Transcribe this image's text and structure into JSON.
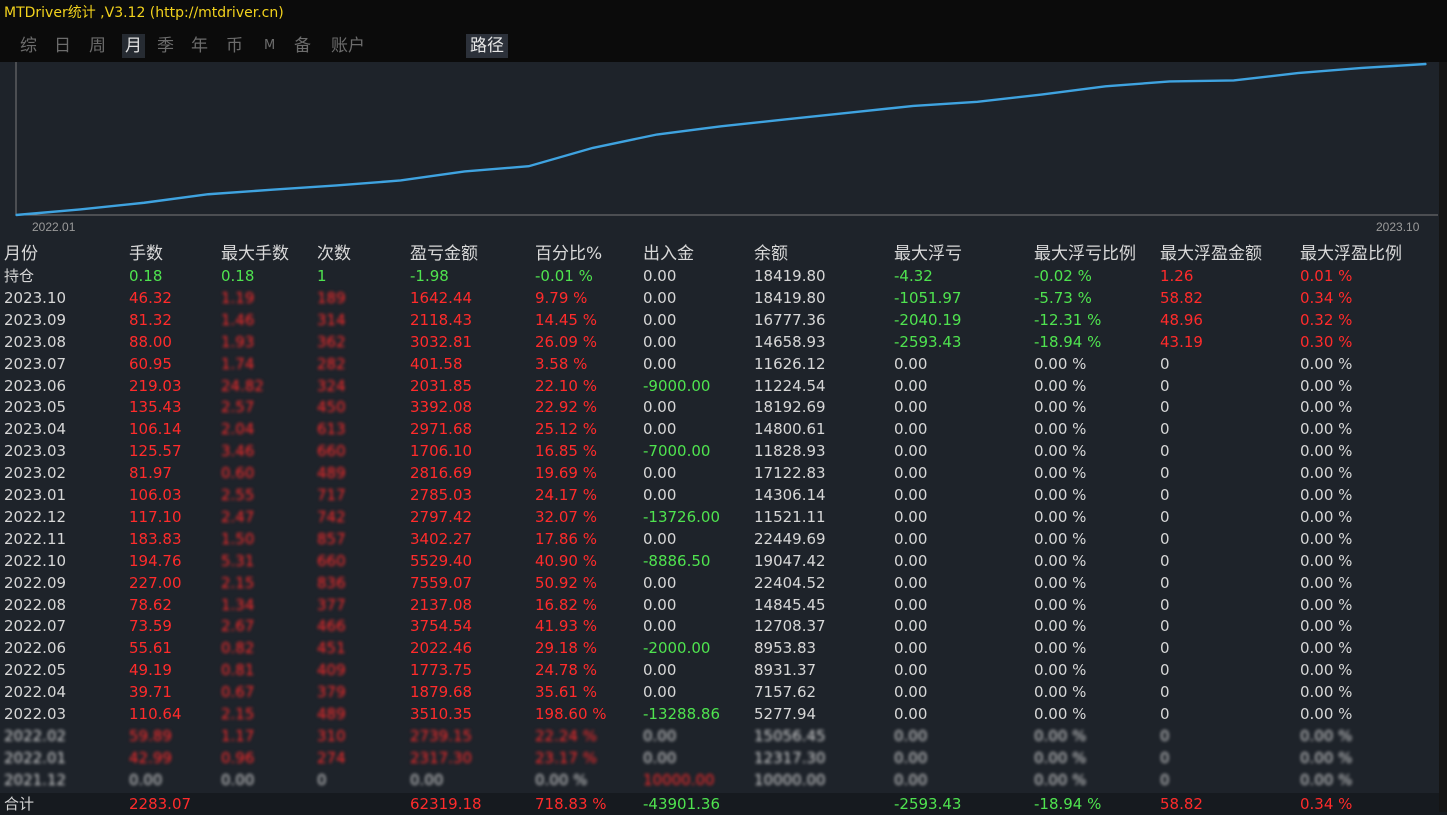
{
  "window": {
    "title": "MTDriver统计 ,V3.12 (http://mtdriver.cn)"
  },
  "tabs": [
    {
      "label": "综",
      "active": false
    },
    {
      "label": "日",
      "active": false
    },
    {
      "label": "周",
      "active": false
    },
    {
      "label": "月",
      "active": true
    },
    {
      "label": "季",
      "active": false
    },
    {
      "label": "年",
      "active": false
    },
    {
      "label": "币",
      "active": false
    },
    {
      "label": "M",
      "active": false
    },
    {
      "label": "备",
      "active": false
    },
    {
      "label": "账户",
      "active": false
    }
  ],
  "path_button": "路径",
  "chart_data": {
    "type": "line",
    "x_start_label": "2022.01",
    "x_end_label": "2023.10",
    "line_color": "#3fa3e0",
    "x": [
      "2021.12",
      "2022.01",
      "2022.02",
      "2022.03",
      "2022.04",
      "2022.05",
      "2022.06",
      "2022.07",
      "2022.08",
      "2022.09",
      "2022.10",
      "2022.11",
      "2022.12",
      "2023.01",
      "2023.02",
      "2023.03",
      "2023.04",
      "2023.05",
      "2023.06",
      "2023.07",
      "2023.08",
      "2023.09",
      "2023.10"
    ],
    "values": [
      0,
      2317,
      5056,
      8566,
      10446,
      12219,
      14241,
      17996,
      20133,
      27692,
      33221,
      36624,
      39421,
      42206,
      45023,
      46729,
      49700,
      53093,
      55124,
      55526,
      58559,
      60677,
      62319
    ]
  },
  "colors": {
    "red": "#ff2b2b",
    "green": "#4fe34f",
    "white": "#d7d7d7"
  },
  "table": {
    "headers": [
      "月份",
      "手数",
      "最大手数",
      "次数",
      "盈亏金额",
      "百分比%",
      "出入金",
      "余额",
      "最大浮亏",
      "最大浮亏比例",
      "最大浮盈金额",
      "最大浮盈比例"
    ],
    "rows": [
      {
        "cells": [
          "持仓",
          "0.18",
          "0.18",
          "1",
          "-1.98",
          "-0.01 %",
          "0.00",
          "18419.80",
          "-4.32",
          "-0.02 %",
          "1.26",
          "0.01 %"
        ],
        "colors": [
          "w",
          "g",
          "g",
          "g",
          "g",
          "g",
          "w",
          "w",
          "g",
          "g",
          "r",
          "r"
        ]
      },
      {
        "cells": [
          "2023.10",
          "46.32",
          "1.19",
          "189",
          "1642.44",
          "9.79 %",
          "0.00",
          "18419.80",
          "-1051.97",
          "-5.73 %",
          "58.82",
          "0.34 %"
        ],
        "colors": [
          "w",
          "r",
          "r",
          "r",
          "r",
          "r",
          "w",
          "w",
          "g",
          "g",
          "r",
          "r"
        ]
      },
      {
        "cells": [
          "2023.09",
          "81.32",
          "1.46",
          "314",
          "2118.43",
          "14.45 %",
          "0.00",
          "16777.36",
          "-2040.19",
          "-12.31 %",
          "48.96",
          "0.32 %"
        ],
        "colors": [
          "w",
          "r",
          "r",
          "r",
          "r",
          "r",
          "w",
          "w",
          "g",
          "g",
          "r",
          "r"
        ]
      },
      {
        "cells": [
          "2023.08",
          "88.00",
          "1.93",
          "362",
          "3032.81",
          "26.09 %",
          "0.00",
          "14658.93",
          "-2593.43",
          "-18.94 %",
          "43.19",
          "0.30 %"
        ],
        "colors": [
          "w",
          "r",
          "r",
          "r",
          "r",
          "r",
          "w",
          "w",
          "g",
          "g",
          "r",
          "r"
        ]
      },
      {
        "cells": [
          "2023.07",
          "60.95",
          "1.74",
          "282",
          "401.58",
          "3.58 %",
          "0.00",
          "11626.12",
          "0.00",
          "0.00 %",
          "0",
          "0.00 %"
        ],
        "colors": [
          "w",
          "r",
          "r",
          "r",
          "r",
          "r",
          "w",
          "w",
          "w",
          "w",
          "w",
          "w"
        ]
      },
      {
        "cells": [
          "2023.06",
          "219.03",
          "24.82",
          "324",
          "2031.85",
          "22.10 %",
          "-9000.00",
          "11224.54",
          "0.00",
          "0.00 %",
          "0",
          "0.00 %"
        ],
        "colors": [
          "w",
          "r",
          "r",
          "r",
          "r",
          "r",
          "g",
          "w",
          "w",
          "w",
          "w",
          "w"
        ]
      },
      {
        "cells": [
          "2023.05",
          "135.43",
          "2.57",
          "450",
          "3392.08",
          "22.92 %",
          "0.00",
          "18192.69",
          "0.00",
          "0.00 %",
          "0",
          "0.00 %"
        ],
        "colors": [
          "w",
          "r",
          "r",
          "r",
          "r",
          "r",
          "w",
          "w",
          "w",
          "w",
          "w",
          "w"
        ]
      },
      {
        "cells": [
          "2023.04",
          "106.14",
          "2.04",
          "613",
          "2971.68",
          "25.12 %",
          "0.00",
          "14800.61",
          "0.00",
          "0.00 %",
          "0",
          "0.00 %"
        ],
        "colors": [
          "w",
          "r",
          "r",
          "r",
          "r",
          "r",
          "w",
          "w",
          "w",
          "w",
          "w",
          "w"
        ]
      },
      {
        "cells": [
          "2023.03",
          "125.57",
          "3.46",
          "660",
          "1706.10",
          "16.85 %",
          "-7000.00",
          "11828.93",
          "0.00",
          "0.00 %",
          "0",
          "0.00 %"
        ],
        "colors": [
          "w",
          "r",
          "r",
          "r",
          "r",
          "r",
          "g",
          "w",
          "w",
          "w",
          "w",
          "w"
        ]
      },
      {
        "cells": [
          "2023.02",
          "81.97",
          "0.60",
          "489",
          "2816.69",
          "19.69 %",
          "0.00",
          "17122.83",
          "0.00",
          "0.00 %",
          "0",
          "0.00 %"
        ],
        "colors": [
          "w",
          "r",
          "r",
          "r",
          "r",
          "r",
          "w",
          "w",
          "w",
          "w",
          "w",
          "w"
        ]
      },
      {
        "cells": [
          "2023.01",
          "106.03",
          "2.55",
          "717",
          "2785.03",
          "24.17 %",
          "0.00",
          "14306.14",
          "0.00",
          "0.00 %",
          "0",
          "0.00 %"
        ],
        "colors": [
          "w",
          "r",
          "r",
          "r",
          "r",
          "r",
          "w",
          "w",
          "w",
          "w",
          "w",
          "w"
        ]
      },
      {
        "cells": [
          "2022.12",
          "117.10",
          "2.47",
          "742",
          "2797.42",
          "32.07 %",
          "-13726.00",
          "11521.11",
          "0.00",
          "0.00 %",
          "0",
          "0.00 %"
        ],
        "colors": [
          "w",
          "r",
          "r",
          "r",
          "r",
          "r",
          "g",
          "w",
          "w",
          "w",
          "w",
          "w"
        ]
      },
      {
        "cells": [
          "2022.11",
          "183.83",
          "1.50",
          "857",
          "3402.27",
          "17.86 %",
          "0.00",
          "22449.69",
          "0.00",
          "0.00 %",
          "0",
          "0.00 %"
        ],
        "colors": [
          "w",
          "r",
          "r",
          "r",
          "r",
          "r",
          "w",
          "w",
          "w",
          "w",
          "w",
          "w"
        ]
      },
      {
        "cells": [
          "2022.10",
          "194.76",
          "5.31",
          "660",
          "5529.40",
          "40.90 %",
          "-8886.50",
          "19047.42",
          "0.00",
          "0.00 %",
          "0",
          "0.00 %"
        ],
        "colors": [
          "w",
          "r",
          "r",
          "r",
          "r",
          "r",
          "g",
          "w",
          "w",
          "w",
          "w",
          "w"
        ]
      },
      {
        "cells": [
          "2022.09",
          "227.00",
          "2.15",
          "836",
          "7559.07",
          "50.92 %",
          "0.00",
          "22404.52",
          "0.00",
          "0.00 %",
          "0",
          "0.00 %"
        ],
        "colors": [
          "w",
          "r",
          "r",
          "r",
          "r",
          "r",
          "w",
          "w",
          "w",
          "w",
          "w",
          "w"
        ]
      },
      {
        "cells": [
          "2022.08",
          "78.62",
          "1.34",
          "377",
          "2137.08",
          "16.82 %",
          "0.00",
          "14845.45",
          "0.00",
          "0.00 %",
          "0",
          "0.00 %"
        ],
        "colors": [
          "w",
          "r",
          "r",
          "r",
          "r",
          "r",
          "w",
          "w",
          "w",
          "w",
          "w",
          "w"
        ]
      },
      {
        "cells": [
          "2022.07",
          "73.59",
          "2.67",
          "466",
          "3754.54",
          "41.93 %",
          "0.00",
          "12708.37",
          "0.00",
          "0.00 %",
          "0",
          "0.00 %"
        ],
        "colors": [
          "w",
          "r",
          "r",
          "r",
          "r",
          "r",
          "w",
          "w",
          "w",
          "w",
          "w",
          "w"
        ]
      },
      {
        "cells": [
          "2022.06",
          "55.61",
          "0.82",
          "451",
          "2022.46",
          "29.18 %",
          "-2000.00",
          "8953.83",
          "0.00",
          "0.00 %",
          "0",
          "0.00 %"
        ],
        "colors": [
          "w",
          "r",
          "r",
          "r",
          "r",
          "r",
          "g",
          "w",
          "w",
          "w",
          "w",
          "w"
        ]
      },
      {
        "cells": [
          "2022.05",
          "49.19",
          "0.81",
          "409",
          "1773.75",
          "24.78 %",
          "0.00",
          "8931.37",
          "0.00",
          "0.00 %",
          "0",
          "0.00 %"
        ],
        "colors": [
          "w",
          "r",
          "r",
          "r",
          "r",
          "r",
          "w",
          "w",
          "w",
          "w",
          "w",
          "w"
        ]
      },
      {
        "cells": [
          "2022.04",
          "39.71",
          "0.67",
          "379",
          "1879.68",
          "35.61 %",
          "0.00",
          "7157.62",
          "0.00",
          "0.00 %",
          "0",
          "0.00 %"
        ],
        "colors": [
          "w",
          "r",
          "r",
          "r",
          "r",
          "r",
          "w",
          "w",
          "w",
          "w",
          "w",
          "w"
        ]
      },
      {
        "cells": [
          "2022.03",
          "110.64",
          "2.15",
          "489",
          "3510.35",
          "198.60 %",
          "-13288.86",
          "5277.94",
          "0.00",
          "0.00 %",
          "0",
          "0.00 %"
        ],
        "colors": [
          "w",
          "r",
          "r",
          "r",
          "r",
          "r",
          "g",
          "w",
          "w",
          "w",
          "w",
          "w"
        ]
      },
      {
        "cells": [
          "2022.02",
          "59.89",
          "1.17",
          "310",
          "2739.15",
          "22.24 %",
          "0.00",
          "15056.45",
          "0.00",
          "0.00 %",
          "0",
          "0.00 %"
        ],
        "colors": [
          "w",
          "r",
          "r",
          "r",
          "r",
          "r",
          "w",
          "w",
          "w",
          "w",
          "w",
          "w"
        ]
      },
      {
        "cells": [
          "2022.01",
          "42.99",
          "0.96",
          "274",
          "2317.30",
          "23.17 %",
          "0.00",
          "12317.30",
          "0.00",
          "0.00 %",
          "0",
          "0.00 %"
        ],
        "colors": [
          "w",
          "r",
          "r",
          "r",
          "r",
          "r",
          "w",
          "w",
          "w",
          "w",
          "w",
          "w"
        ]
      },
      {
        "cells": [
          "2021.12",
          "0.00",
          "0.00",
          "0",
          "0.00",
          "0.00 %",
          "10000.00",
          "10000.00",
          "0.00",
          "0.00 %",
          "0",
          "0.00 %"
        ],
        "colors": [
          "w",
          "w",
          "w",
          "w",
          "w",
          "w",
          "r",
          "w",
          "w",
          "w",
          "w",
          "w"
        ]
      }
    ],
    "total": {
      "cells": [
        "合计",
        "2283.07",
        "",
        "",
        "62319.18",
        "718.83 %",
        "-43901.36",
        "",
        "-2593.43",
        "-18.94 %",
        "58.82",
        "0.34 %"
      ],
      "colors": [
        "w",
        "r",
        "w",
        "w",
        "r",
        "r",
        "g",
        "w",
        "g",
        "g",
        "r",
        "r"
      ]
    }
  }
}
